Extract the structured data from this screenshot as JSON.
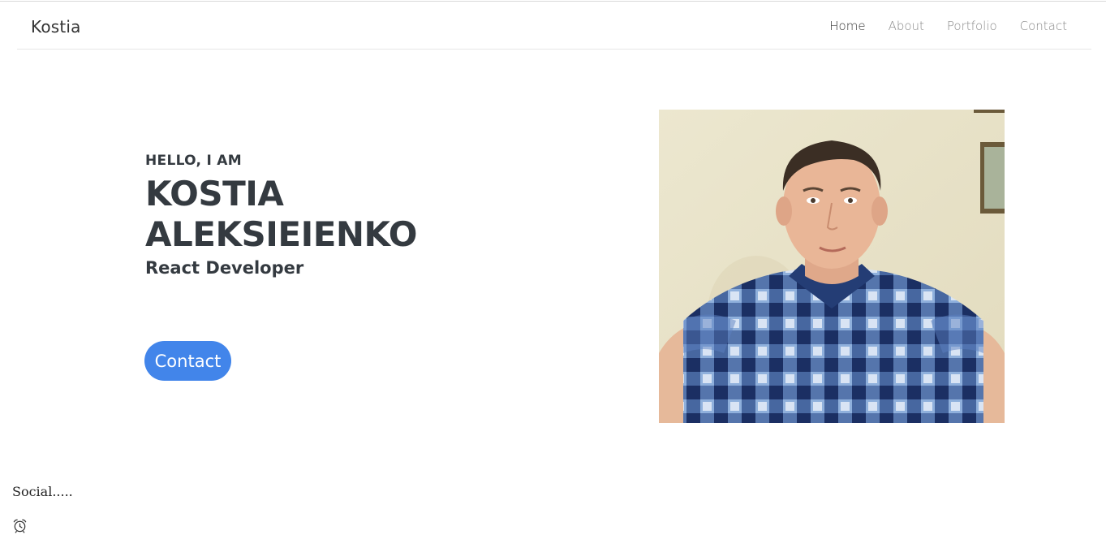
{
  "navbar": {
    "brand": "Kostia",
    "links": [
      {
        "label": "Home",
        "active": true
      },
      {
        "label": "About",
        "active": false
      },
      {
        "label": "Portfolio",
        "active": false
      },
      {
        "label": "Contact",
        "active": false
      }
    ]
  },
  "hero": {
    "greeting": "HELLO, I AM",
    "name_line1": "KOSTIA",
    "name_line2": "ALEKSIEIENKO",
    "role": "React Developer",
    "button_label": "Contact",
    "photo_alt": "Kostia Aleksieienko"
  },
  "footer": {
    "social_text": "Social.....",
    "icon": "alarm-clock-icon"
  },
  "colors": {
    "accent": "#4285ea",
    "text": "#343a40"
  }
}
